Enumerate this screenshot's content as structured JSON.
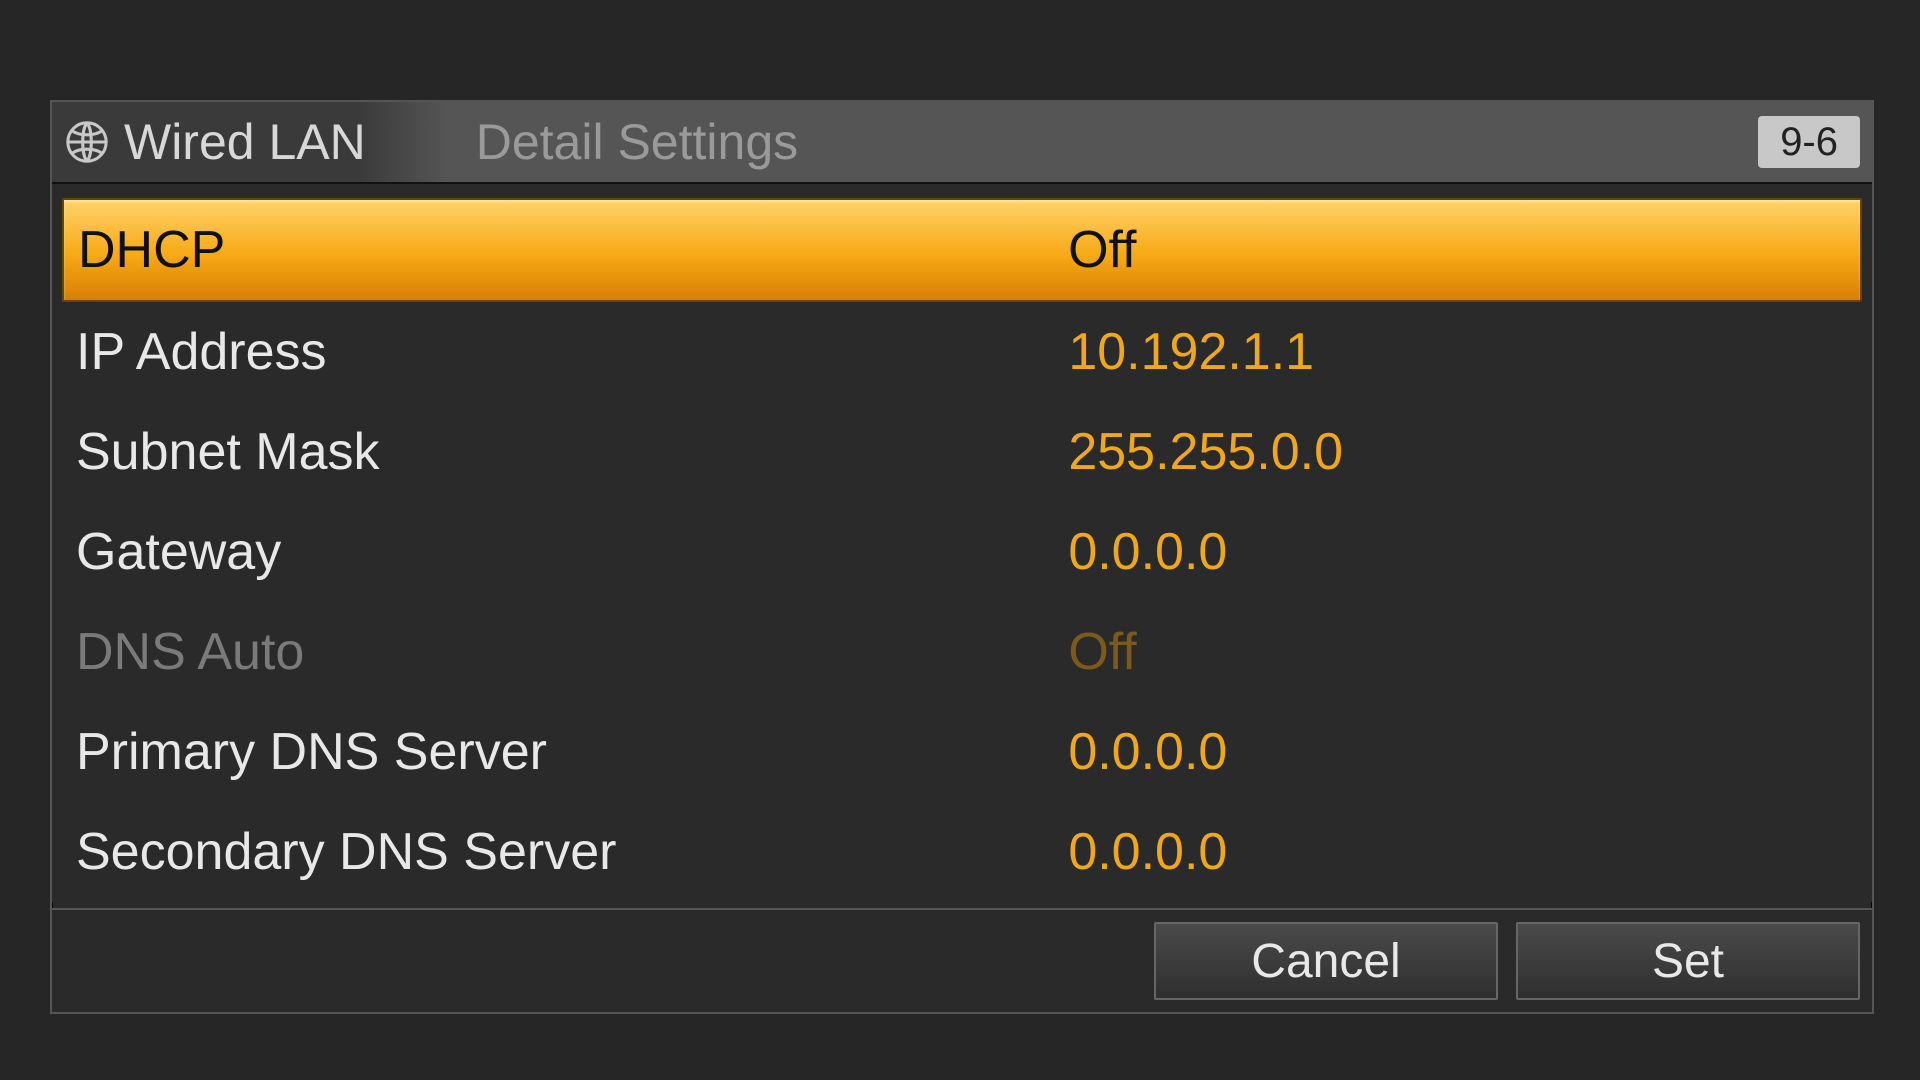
{
  "header": {
    "crumb_active": "Wired LAN",
    "crumb_inactive": "Detail Settings",
    "page_badge": "9-6"
  },
  "rows": [
    {
      "label": "DHCP",
      "value": "Off",
      "selected": true,
      "disabled": false
    },
    {
      "label": "IP Address",
      "value": "10.192.1.1",
      "selected": false,
      "disabled": false
    },
    {
      "label": "Subnet Mask",
      "value": "255.255.0.0",
      "selected": false,
      "disabled": false
    },
    {
      "label": "Gateway",
      "value": "0.0.0.0",
      "selected": false,
      "disabled": false
    },
    {
      "label": "DNS Auto",
      "value": "Off",
      "selected": false,
      "disabled": true
    },
    {
      "label": "Primary DNS Server",
      "value": "0.0.0.0",
      "selected": false,
      "disabled": false
    },
    {
      "label": "Secondary DNS Server",
      "value": "0.0.0.0",
      "selected": false,
      "disabled": false
    }
  ],
  "footer": {
    "cancel_label": "Cancel",
    "set_label": "Set"
  }
}
